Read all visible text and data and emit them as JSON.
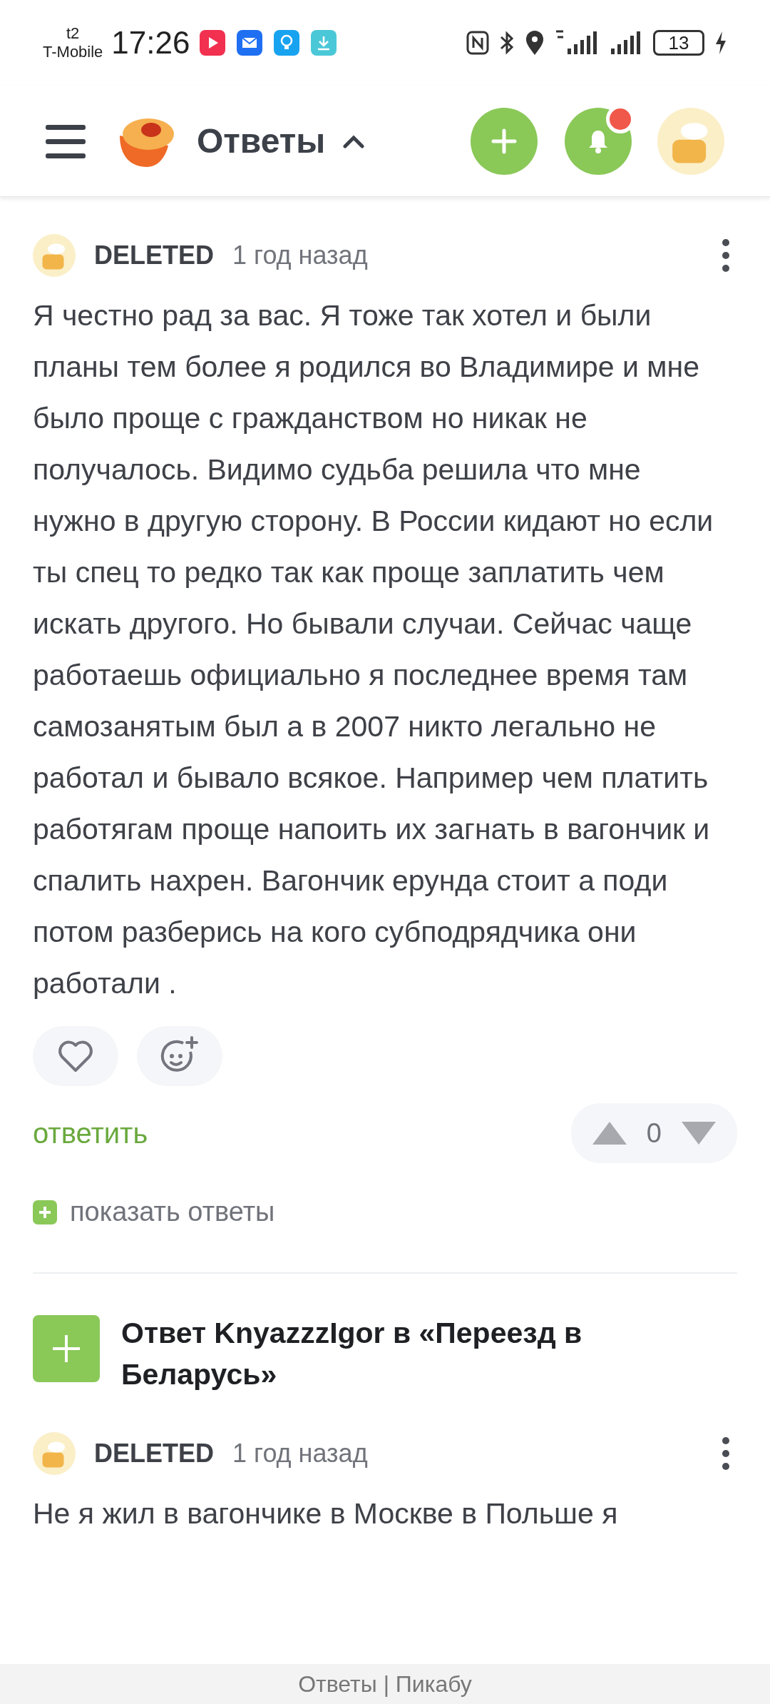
{
  "status_bar": {
    "carrier_top": "t2",
    "carrier": "T-Mobile",
    "time": "17:26",
    "battery": "13"
  },
  "header": {
    "title": "Ответы",
    "notifications_unread": true
  },
  "comment": {
    "author": "DELETED",
    "time": "1 год назад",
    "text": "Я честно рад за вас. Я тоже так хотел и были планы тем более я родился во Владимире и мне было проще с гражданством но никак не получалось. Видимо судьба решила что мне нужно в другую сторону. В России кидают но если ты спец то редко так как проще заплатить чем искать другого. Но бывали случаи. Сейчас чаще работаешь официально я последнее время там самозанятым был а в 2007 никто легально не работал и бывало всякое. Например чем платить работягам проще напоить их загнать в вагончик и спалить нахрен. Вагончик ерунда стоит а поди потом разберись на кого субподрядчика они работали .",
    "reply": "ответить",
    "votes": "0",
    "show_replies": "показать ответы"
  },
  "answer": {
    "title": "Ответ KnyazzzIgor в «Переезд в Беларусь»"
  },
  "comment_2": {
    "author": "DELETED",
    "time": "1 год назад",
    "text": "Не я жил в вагончике в Москве в Польше я"
  },
  "footer": {
    "text": "Ответы | Пикабу"
  }
}
